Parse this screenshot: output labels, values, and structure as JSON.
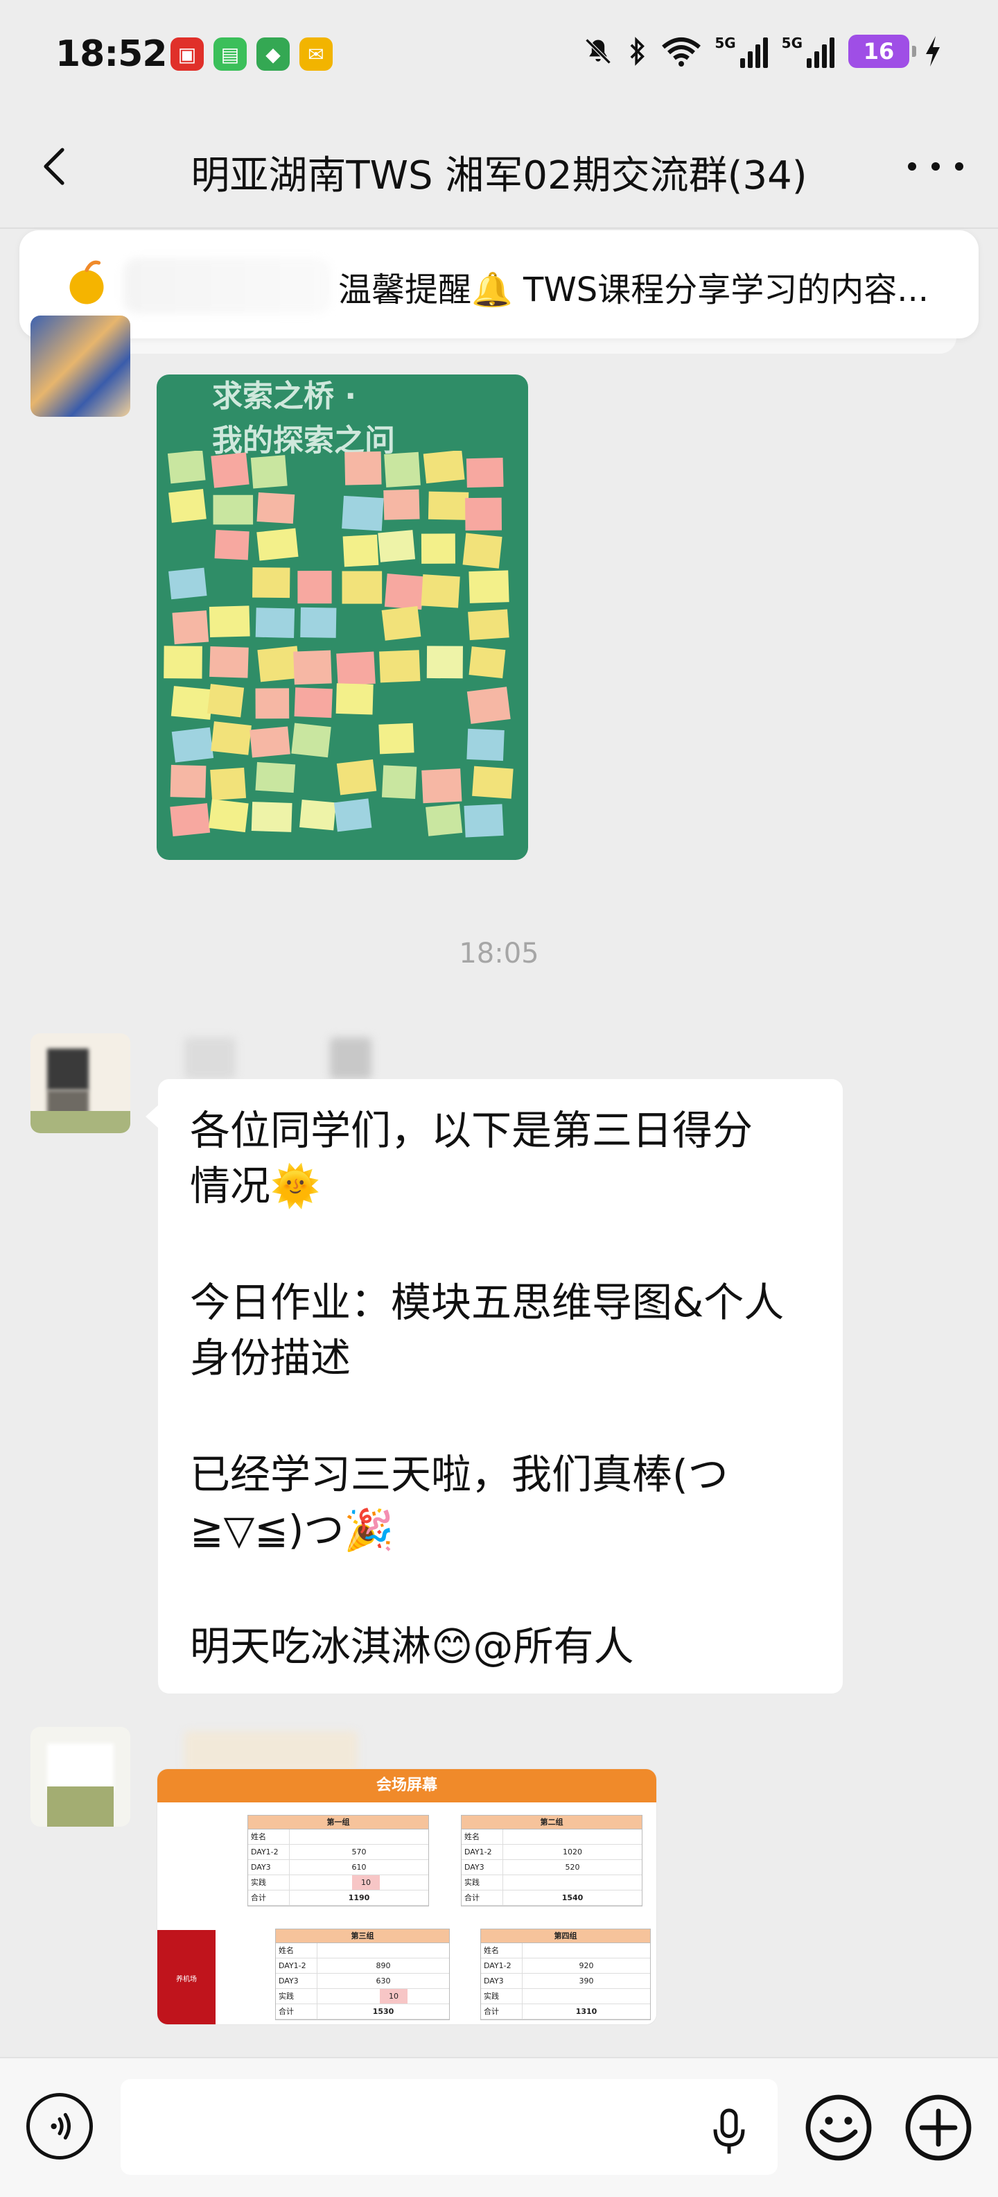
{
  "status_bar": {
    "time": "18:52",
    "network_1": "5G",
    "network_2": "5G",
    "battery": "16"
  },
  "header": {
    "title": "明亚湖南TWS 湘军02期交流群(34)"
  },
  "pinned_notice": {
    "text": "温馨提醒🔔 TWS课程分享学习的内容..."
  },
  "messages": {
    "photo": {
      "board_title_line1": "求索之桥 ·",
      "board_title_line2": "我的探索之问"
    },
    "time_separator": "18:05",
    "text": {
      "lines": [
        "各位同学们，以下是第三日得分",
        "情况🌞",
        "今日作业：模块五思维导图&个人",
        "身份描述",
        "已经学习三天啦，我们真棒(つ",
        "≧▽≦)つ🎉",
        "明天吃冰淇淋😊@所有人"
      ]
    },
    "spreadsheet": {
      "title": "会场屏幕",
      "side_label": "养机场",
      "groups": [
        {
          "name": "第一组",
          "rows": [
            [
              "姓名",
              ""
            ],
            [
              "DAY1-2",
              "570"
            ],
            [
              "DAY3",
              "610"
            ],
            [
              "实践",
              "10"
            ],
            [
              "合计",
              "1190"
            ]
          ]
        },
        {
          "name": "第二组",
          "rows": [
            [
              "姓名",
              ""
            ],
            [
              "DAY1-2",
              "1020"
            ],
            [
              "DAY3",
              "520"
            ],
            [
              "实践",
              ""
            ],
            [
              "合计",
              "1540"
            ]
          ]
        },
        {
          "name": "第三组",
          "rows": [
            [
              "姓名",
              ""
            ],
            [
              "DAY1-2",
              "890"
            ],
            [
              "DAY3",
              "630"
            ],
            [
              "实践",
              "10"
            ],
            [
              "合计",
              "1530"
            ]
          ]
        },
        {
          "name": "第四组",
          "rows": [
            [
              "姓名",
              ""
            ],
            [
              "DAY1-2",
              "920"
            ],
            [
              "DAY3",
              "390"
            ],
            [
              "实践",
              ""
            ],
            [
              "合计",
              "1310"
            ]
          ]
        }
      ]
    }
  },
  "colors": {
    "background": "#ededed",
    "bubble": "#ffffff",
    "battery": "#9f4ee6",
    "sheet_header": "#f08a2a",
    "sheet_side": "#c0141c",
    "board": "#2f8d67"
  },
  "icons": {
    "back": "chevron-left-icon",
    "more": "more-dots-icon",
    "pin": "notice-icon",
    "voice": "voice-icon",
    "mic": "mic-icon",
    "emoji": "emoji-icon",
    "plus": "plus-icon"
  }
}
